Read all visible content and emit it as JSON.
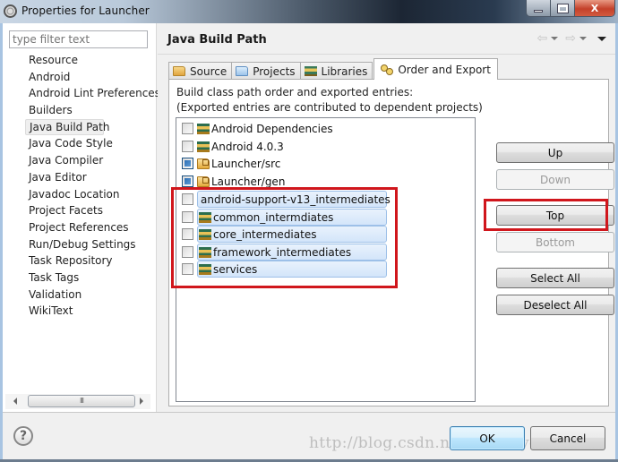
{
  "window": {
    "title": "Properties for Launcher",
    "controls": {
      "minimize": "minimize",
      "maximize": "maximize",
      "close": "X"
    }
  },
  "sidebar": {
    "filter_placeholder": "type filter text",
    "filter_value": "",
    "items": [
      {
        "label": "Resource",
        "selected": false
      },
      {
        "label": "Android",
        "selected": false
      },
      {
        "label": "Android Lint Preferences",
        "selected": false
      },
      {
        "label": "Builders",
        "selected": false
      },
      {
        "label": "Java Build Path",
        "selected": true
      },
      {
        "label": "Java Code Style",
        "selected": false
      },
      {
        "label": "Java Compiler",
        "selected": false
      },
      {
        "label": "Java Editor",
        "selected": false
      },
      {
        "label": "Javadoc Location",
        "selected": false
      },
      {
        "label": "Project Facets",
        "selected": false
      },
      {
        "label": "Project References",
        "selected": false
      },
      {
        "label": "Run/Debug Settings",
        "selected": false
      },
      {
        "label": "Task Repository",
        "selected": false
      },
      {
        "label": "Task Tags",
        "selected": false
      },
      {
        "label": "Validation",
        "selected": false
      },
      {
        "label": "WikiText",
        "selected": false
      }
    ],
    "scrollbar_thumb_grip": "III"
  },
  "main": {
    "title": "Java Build Path",
    "nav": {
      "back": "⇦",
      "forward": "⇨"
    },
    "tabs": [
      {
        "label": "Source",
        "icon": "source-folder-icon",
        "active": false
      },
      {
        "label": "Projects",
        "icon": "projects-folder-icon",
        "active": false
      },
      {
        "label": "Libraries",
        "icon": "libraries-icon",
        "active": false
      },
      {
        "label": "Order and Export",
        "icon": "order-export-icon",
        "active": true
      }
    ],
    "description_line1": "Build class path order and exported entries:",
    "description_line2": "(Exported entries are contributed to dependent projects)",
    "entries": [
      {
        "label": "Android Dependencies",
        "checked": false,
        "icon": "library-icon",
        "highlighted": false
      },
      {
        "label": "Android 4.0.3",
        "checked": false,
        "icon": "library-icon",
        "highlighted": false
      },
      {
        "label": "Launcher/src",
        "checked": true,
        "icon": "source-folder-icon",
        "highlighted": false
      },
      {
        "label": "Launcher/gen",
        "checked": true,
        "icon": "source-folder-icon",
        "highlighted": false
      },
      {
        "label": "android-support-v13_intermediates",
        "checked": false,
        "icon": "library-icon",
        "highlighted": true
      },
      {
        "label": "common_intermdiates",
        "checked": false,
        "icon": "library-icon",
        "highlighted": true
      },
      {
        "label": "core_intermediates",
        "checked": false,
        "icon": "library-icon",
        "highlighted": true
      },
      {
        "label": "framework_intermediates",
        "checked": false,
        "icon": "library-icon",
        "highlighted": true
      },
      {
        "label": "services",
        "checked": false,
        "icon": "library-icon",
        "highlighted": true
      }
    ],
    "buttons": {
      "up": {
        "label": "Up",
        "enabled": true
      },
      "down": {
        "label": "Down",
        "enabled": false
      },
      "top": {
        "label": "Top",
        "enabled": true
      },
      "bottom": {
        "label": "Bottom",
        "enabled": false
      },
      "select_all": {
        "label": "Select All",
        "enabled": true
      },
      "deselect_all": {
        "label": "Deselect All",
        "enabled": true
      }
    }
  },
  "footer": {
    "help": "?",
    "ok": "OK",
    "cancel": "Cancel",
    "watermark": "http://blog.csdn.net/helloliyewen"
  },
  "annotations": {
    "highlight_color": "#d0161c"
  }
}
